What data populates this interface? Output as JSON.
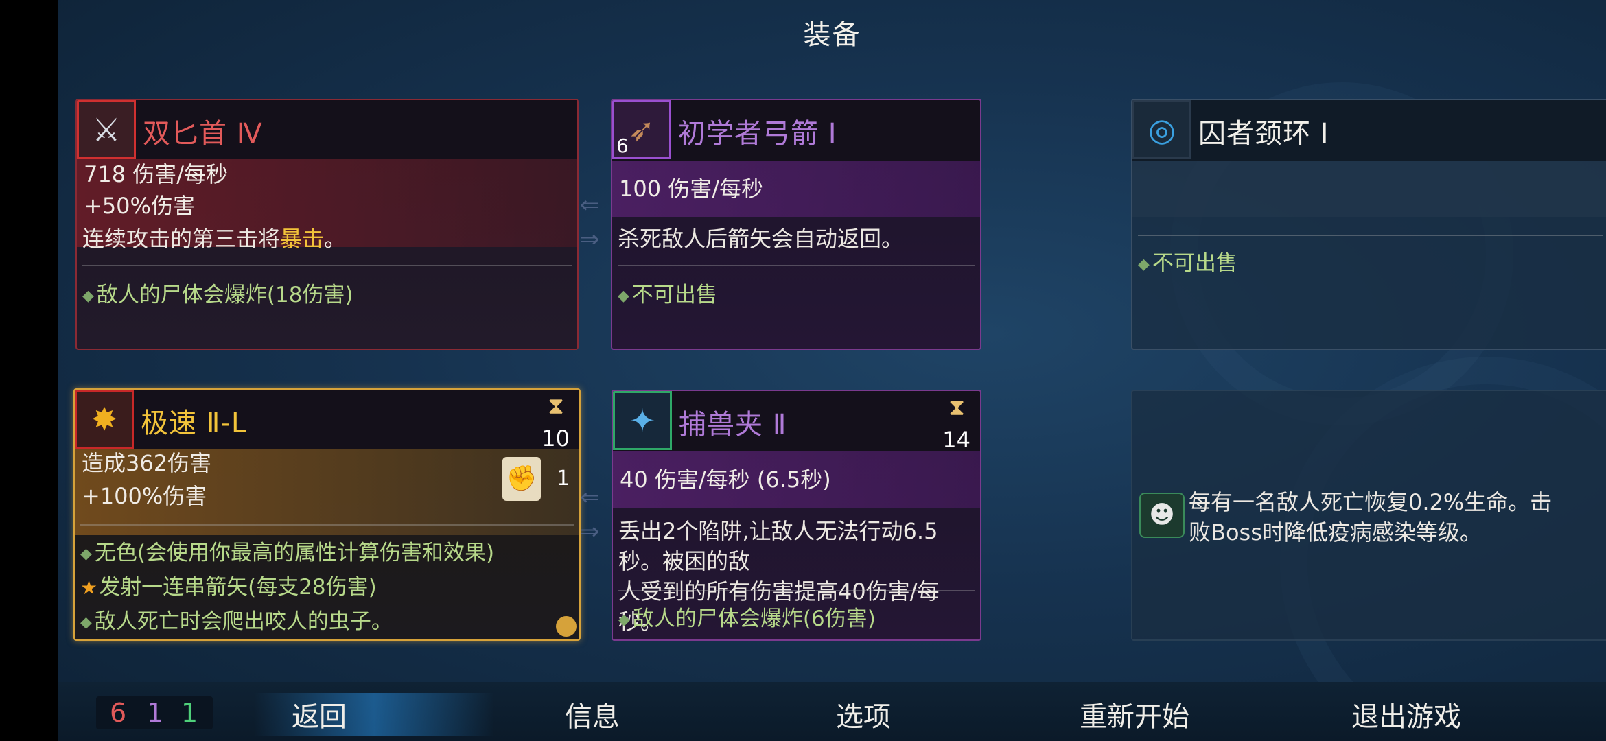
{
  "title": "装备",
  "cards": {
    "c1": {
      "name": "双匕首 Ⅳ",
      "stat1": "718 伤害/每秒",
      "stat2": "+50%伤害",
      "desc_pre": "连续攻击的第三击将",
      "desc_hi": "暴击",
      "desc_post": "。",
      "bullet1": "敌人的尸体会爆炸(18伤害)"
    },
    "c2": {
      "name": "初学者弓箭 Ⅰ",
      "badge": "6",
      "stat1": "100 伤害/每秒",
      "desc": "杀死敌人后箭矢会自动返回。",
      "bullet1": "不可出售"
    },
    "c3": {
      "name": "囚者颈环 Ⅰ",
      "bullet1": "不可出售"
    },
    "c4": {
      "name": "极速 Ⅱ-L",
      "cooldown": "10",
      "scroll_count": "1",
      "stat1": "造成362伤害",
      "stat2": "+100%伤害",
      "bullet1": "无色(会使用你最高的属性计算伤害和效果)",
      "bullet2": "发射一连串箭矢(每支28伤害)",
      "bullet3": "敌人死亡时会爬出咬人的虫子。"
    },
    "c5": {
      "name": "捕兽夹 Ⅱ",
      "cooldown": "14",
      "stat1": "40 伤害/每秒 (6.5秒)",
      "desc1": "丢出2个陷阱,让敌人无法行动6.5秒。被困的敌",
      "desc2": "人受到的所有伤害提高40伤害/每秒。",
      "bullet1": "敌人的尸体会爆炸(6伤害)"
    },
    "c6": {
      "desc1": "每有一名敌人死亡恢复0.2%生命。击",
      "desc2": "败Boss时降低疫病感染等级。"
    }
  },
  "stats": {
    "brutality": "6",
    "tactics": "1",
    "survival": "1"
  },
  "nav": {
    "back": "返回",
    "info": "信息",
    "options": "选项",
    "restart": "重新开始",
    "quit": "退出游戏"
  },
  "colors": {
    "red": "#e25a5a",
    "purple": "#b07ad8",
    "green": "#4fd07a",
    "gold": "#f2c33a"
  }
}
